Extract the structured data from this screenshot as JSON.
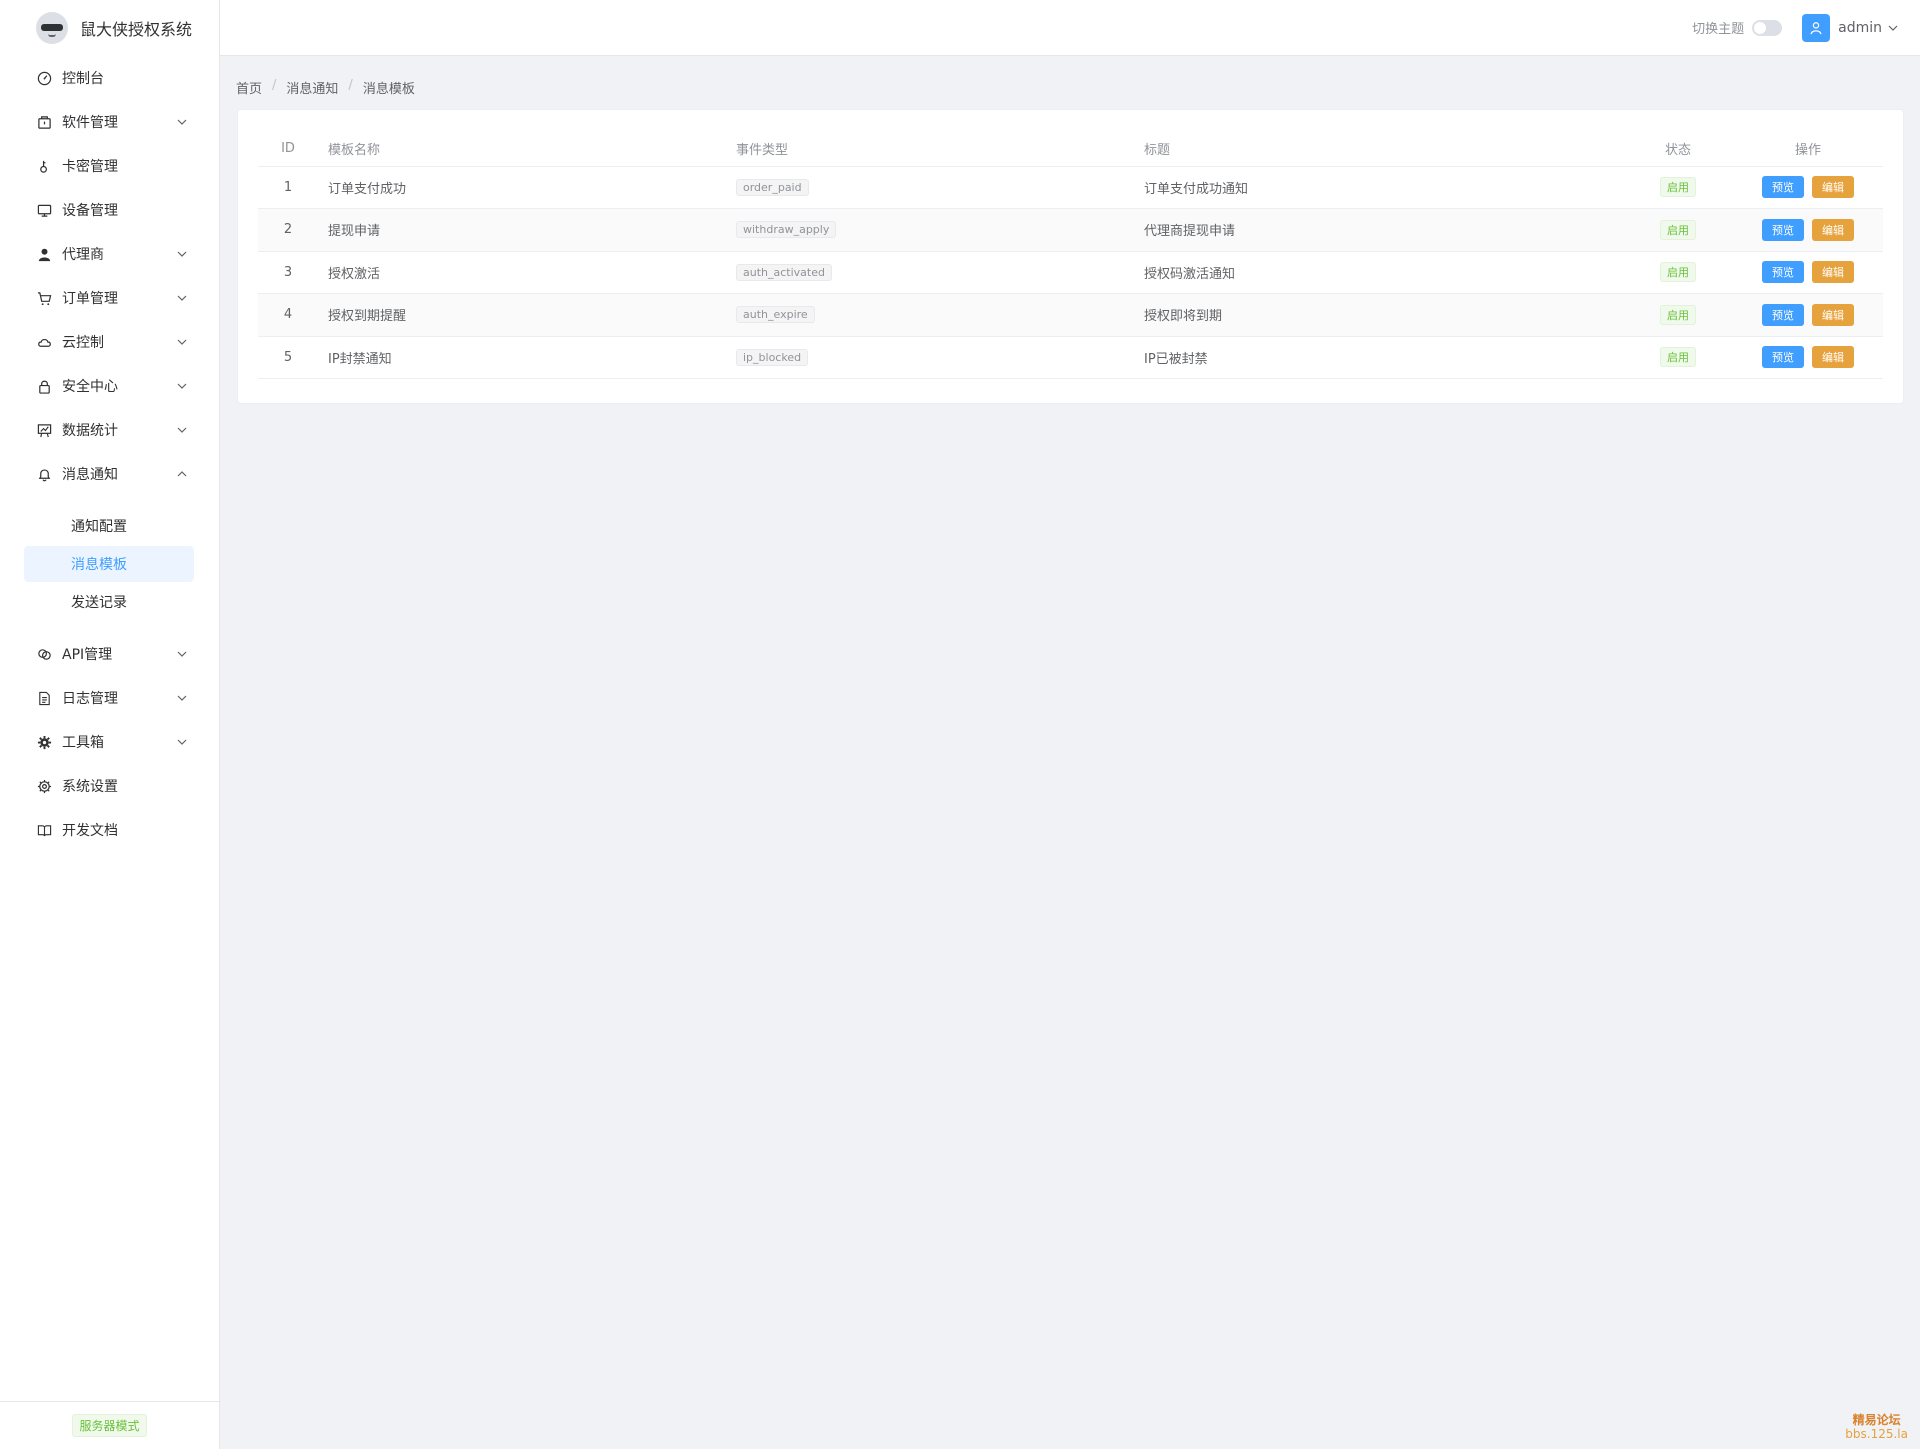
{
  "brand": {
    "title": "鼠大侠授权系统"
  },
  "header": {
    "theme_label": "切换主题",
    "user_name": "admin"
  },
  "sidebar": {
    "items": [
      {
        "label": "控制台",
        "icon": "dashboard-icon",
        "expandable": false
      },
      {
        "label": "软件管理",
        "icon": "package-icon",
        "expandable": true
      },
      {
        "label": "卡密管理",
        "icon": "key-icon",
        "expandable": false
      },
      {
        "label": "设备管理",
        "icon": "monitor-icon",
        "expandable": false
      },
      {
        "label": "代理商",
        "icon": "user-icon",
        "expandable": true
      },
      {
        "label": "订单管理",
        "icon": "cart-icon",
        "expandable": true
      },
      {
        "label": "云控制",
        "icon": "cloud-icon",
        "expandable": true
      },
      {
        "label": "安全中心",
        "icon": "lock-icon",
        "expandable": true
      },
      {
        "label": "数据统计",
        "icon": "chart-icon",
        "expandable": true
      },
      {
        "label": "消息通知",
        "icon": "bell-icon",
        "expandable": true,
        "expanded": true,
        "children": [
          "通知配置",
          "消息模板",
          "发送记录"
        ]
      },
      {
        "label": "API管理",
        "icon": "link-icon",
        "expandable": true
      },
      {
        "label": "日志管理",
        "icon": "document-icon",
        "expandable": true
      },
      {
        "label": "工具箱",
        "icon": "tool-icon",
        "expandable": true
      },
      {
        "label": "系统设置",
        "icon": "gear-icon",
        "expandable": false
      },
      {
        "label": "开发文档",
        "icon": "book-icon",
        "expandable": false
      }
    ],
    "active_child": "消息模板",
    "footer_tag": "服务器模式"
  },
  "breadcrumb": [
    "首页",
    "消息通知",
    "消息模板"
  ],
  "table": {
    "headers": [
      "ID",
      "模板名称",
      "事件类型",
      "标题",
      "状态",
      "操作"
    ],
    "rows": [
      {
        "id": "1",
        "name": "订单支付成功",
        "event": "order_paid",
        "title": "订单支付成功通知",
        "status": "启用"
      },
      {
        "id": "2",
        "name": "提现申请",
        "event": "withdraw_apply",
        "title": "代理商提现申请",
        "status": "启用"
      },
      {
        "id": "3",
        "name": "授权激活",
        "event": "auth_activated",
        "title": "授权码激活通知",
        "status": "启用"
      },
      {
        "id": "4",
        "name": "授权到期提醒",
        "event": "auth_expire",
        "title": "授权即将到期",
        "status": "启用"
      },
      {
        "id": "5",
        "name": "IP封禁通知",
        "event": "ip_blocked",
        "title": "IP已被封禁",
        "status": "启用"
      }
    ],
    "preview_label": "预览",
    "edit_label": "编辑"
  },
  "watermark": {
    "line1": "精易论坛",
    "line2": "bbs.125.la"
  },
  "colors": {
    "primary": "#409eff",
    "warning": "#e6a23c",
    "success": "#67c23a"
  }
}
